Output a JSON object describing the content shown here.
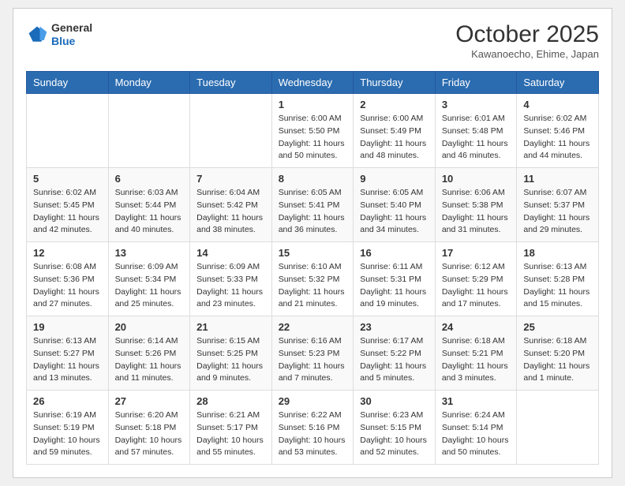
{
  "header": {
    "logo": {
      "general": "General",
      "blue": "Blue"
    },
    "title": "October 2025",
    "subtitle": "Kawanoecho, Ehime, Japan"
  },
  "weekdays": [
    "Sunday",
    "Monday",
    "Tuesday",
    "Wednesday",
    "Thursday",
    "Friday",
    "Saturday"
  ],
  "weeks": [
    [
      {
        "day": "",
        "info": ""
      },
      {
        "day": "",
        "info": ""
      },
      {
        "day": "",
        "info": ""
      },
      {
        "day": "1",
        "info": "Sunrise: 6:00 AM\nSunset: 5:50 PM\nDaylight: 11 hours\nand 50 minutes."
      },
      {
        "day": "2",
        "info": "Sunrise: 6:00 AM\nSunset: 5:49 PM\nDaylight: 11 hours\nand 48 minutes."
      },
      {
        "day": "3",
        "info": "Sunrise: 6:01 AM\nSunset: 5:48 PM\nDaylight: 11 hours\nand 46 minutes."
      },
      {
        "day": "4",
        "info": "Sunrise: 6:02 AM\nSunset: 5:46 PM\nDaylight: 11 hours\nand 44 minutes."
      }
    ],
    [
      {
        "day": "5",
        "info": "Sunrise: 6:02 AM\nSunset: 5:45 PM\nDaylight: 11 hours\nand 42 minutes."
      },
      {
        "day": "6",
        "info": "Sunrise: 6:03 AM\nSunset: 5:44 PM\nDaylight: 11 hours\nand 40 minutes."
      },
      {
        "day": "7",
        "info": "Sunrise: 6:04 AM\nSunset: 5:42 PM\nDaylight: 11 hours\nand 38 minutes."
      },
      {
        "day": "8",
        "info": "Sunrise: 6:05 AM\nSunset: 5:41 PM\nDaylight: 11 hours\nand 36 minutes."
      },
      {
        "day": "9",
        "info": "Sunrise: 6:05 AM\nSunset: 5:40 PM\nDaylight: 11 hours\nand 34 minutes."
      },
      {
        "day": "10",
        "info": "Sunrise: 6:06 AM\nSunset: 5:38 PM\nDaylight: 11 hours\nand 31 minutes."
      },
      {
        "day": "11",
        "info": "Sunrise: 6:07 AM\nSunset: 5:37 PM\nDaylight: 11 hours\nand 29 minutes."
      }
    ],
    [
      {
        "day": "12",
        "info": "Sunrise: 6:08 AM\nSunset: 5:36 PM\nDaylight: 11 hours\nand 27 minutes."
      },
      {
        "day": "13",
        "info": "Sunrise: 6:09 AM\nSunset: 5:34 PM\nDaylight: 11 hours\nand 25 minutes."
      },
      {
        "day": "14",
        "info": "Sunrise: 6:09 AM\nSunset: 5:33 PM\nDaylight: 11 hours\nand 23 minutes."
      },
      {
        "day": "15",
        "info": "Sunrise: 6:10 AM\nSunset: 5:32 PM\nDaylight: 11 hours\nand 21 minutes."
      },
      {
        "day": "16",
        "info": "Sunrise: 6:11 AM\nSunset: 5:31 PM\nDaylight: 11 hours\nand 19 minutes."
      },
      {
        "day": "17",
        "info": "Sunrise: 6:12 AM\nSunset: 5:29 PM\nDaylight: 11 hours\nand 17 minutes."
      },
      {
        "day": "18",
        "info": "Sunrise: 6:13 AM\nSunset: 5:28 PM\nDaylight: 11 hours\nand 15 minutes."
      }
    ],
    [
      {
        "day": "19",
        "info": "Sunrise: 6:13 AM\nSunset: 5:27 PM\nDaylight: 11 hours\nand 13 minutes."
      },
      {
        "day": "20",
        "info": "Sunrise: 6:14 AM\nSunset: 5:26 PM\nDaylight: 11 hours\nand 11 minutes."
      },
      {
        "day": "21",
        "info": "Sunrise: 6:15 AM\nSunset: 5:25 PM\nDaylight: 11 hours\nand 9 minutes."
      },
      {
        "day": "22",
        "info": "Sunrise: 6:16 AM\nSunset: 5:23 PM\nDaylight: 11 hours\nand 7 minutes."
      },
      {
        "day": "23",
        "info": "Sunrise: 6:17 AM\nSunset: 5:22 PM\nDaylight: 11 hours\nand 5 minutes."
      },
      {
        "day": "24",
        "info": "Sunrise: 6:18 AM\nSunset: 5:21 PM\nDaylight: 11 hours\nand 3 minutes."
      },
      {
        "day": "25",
        "info": "Sunrise: 6:18 AM\nSunset: 5:20 PM\nDaylight: 11 hours\nand 1 minute."
      }
    ],
    [
      {
        "day": "26",
        "info": "Sunrise: 6:19 AM\nSunset: 5:19 PM\nDaylight: 10 hours\nand 59 minutes."
      },
      {
        "day": "27",
        "info": "Sunrise: 6:20 AM\nSunset: 5:18 PM\nDaylight: 10 hours\nand 57 minutes."
      },
      {
        "day": "28",
        "info": "Sunrise: 6:21 AM\nSunset: 5:17 PM\nDaylight: 10 hours\nand 55 minutes."
      },
      {
        "day": "29",
        "info": "Sunrise: 6:22 AM\nSunset: 5:16 PM\nDaylight: 10 hours\nand 53 minutes."
      },
      {
        "day": "30",
        "info": "Sunrise: 6:23 AM\nSunset: 5:15 PM\nDaylight: 10 hours\nand 52 minutes."
      },
      {
        "day": "31",
        "info": "Sunrise: 6:24 AM\nSunset: 5:14 PM\nDaylight: 10 hours\nand 50 minutes."
      },
      {
        "day": "",
        "info": ""
      }
    ]
  ]
}
